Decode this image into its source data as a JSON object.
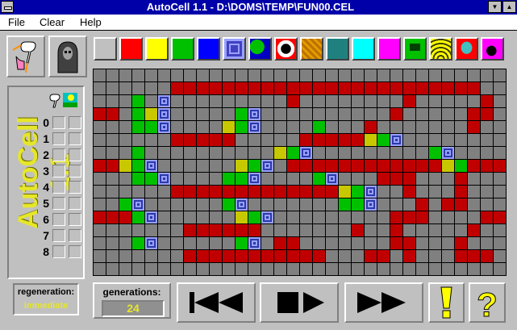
{
  "window": {
    "title": "AutoCell 1.1 - D:\\DOMS\\TEMP\\FUN00.CEL"
  },
  "menu": [
    {
      "label": "File"
    },
    {
      "label": "Clear"
    },
    {
      "label": "Help"
    }
  ],
  "palette": [
    {
      "name": "gray",
      "color": "#c0c0c0"
    },
    {
      "name": "red",
      "color": "#ff0000"
    },
    {
      "name": "yellow",
      "color": "#ffff00"
    },
    {
      "name": "green",
      "color": "#00c000"
    },
    {
      "name": "blue",
      "color": "#0000ff"
    },
    {
      "name": "concentric",
      "color": "#4040c0"
    },
    {
      "name": "map",
      "color": "#00a000"
    },
    {
      "name": "yin-yang",
      "color": "#ff0000"
    },
    {
      "name": "pattern",
      "color": "#c07000"
    },
    {
      "name": "teal",
      "color": "#208080"
    },
    {
      "name": "cyan",
      "color": "#00ffff"
    },
    {
      "name": "magenta",
      "color": "#ff00ff"
    },
    {
      "name": "computer",
      "color": "#ffff00"
    },
    {
      "name": "radio-waves",
      "color": "#ffff00"
    },
    {
      "name": "alien",
      "color": "#ff0000"
    },
    {
      "name": "bomb",
      "color": "#ff00ff"
    }
  ],
  "sidebar": {
    "vertical_title": "AutoCell 1.1",
    "rows": [
      "0",
      "1",
      "2",
      "3",
      "4",
      "5",
      "6",
      "7",
      "8"
    ]
  },
  "regeneration": {
    "label": "regeneration:",
    "value": "immediate"
  },
  "generations": {
    "label": "generations:",
    "value": "24"
  },
  "grid": {
    "cols": 32,
    "rows": 16,
    "cells": [
      "................................",
      "......RRRRRRRRRRRRRRRRRRRRRRRR..",
      "...G.B.........R........R.....R.",
      "RR.GYB.....GB..........R.....RR.",
      "...GGB....YGB....G...R.......R..",
      "......RRRRR.....RRRRRYGB........",
      "...G..........YGB.........GB....",
      "RRYGB......YGB.RRRRRRRRRRRRYGRRR",
      "...GGB....GGB....GB...RRR...R...",
      "......RRRRRRRRRRRRRYGB..R...R...",
      "..GB......GB.......GGB...R.RR...",
      "RRRGB......YGB.........RRR....RR",
      ".......RRRRRR.......R..R.....R..",
      "...GB......GB.RR.......RR...R...",
      ".......RRRRRRRRRRR...RR.R...RRR.",
      "................................"
    ]
  },
  "colors": {
    "red": "#c00000",
    "green": "#00c000",
    "yellow": "#c8c800",
    "blue": "#0000c0",
    "gray": "#808080",
    "bright_green": "#00ff00",
    "bright_red": "#ff0000"
  }
}
